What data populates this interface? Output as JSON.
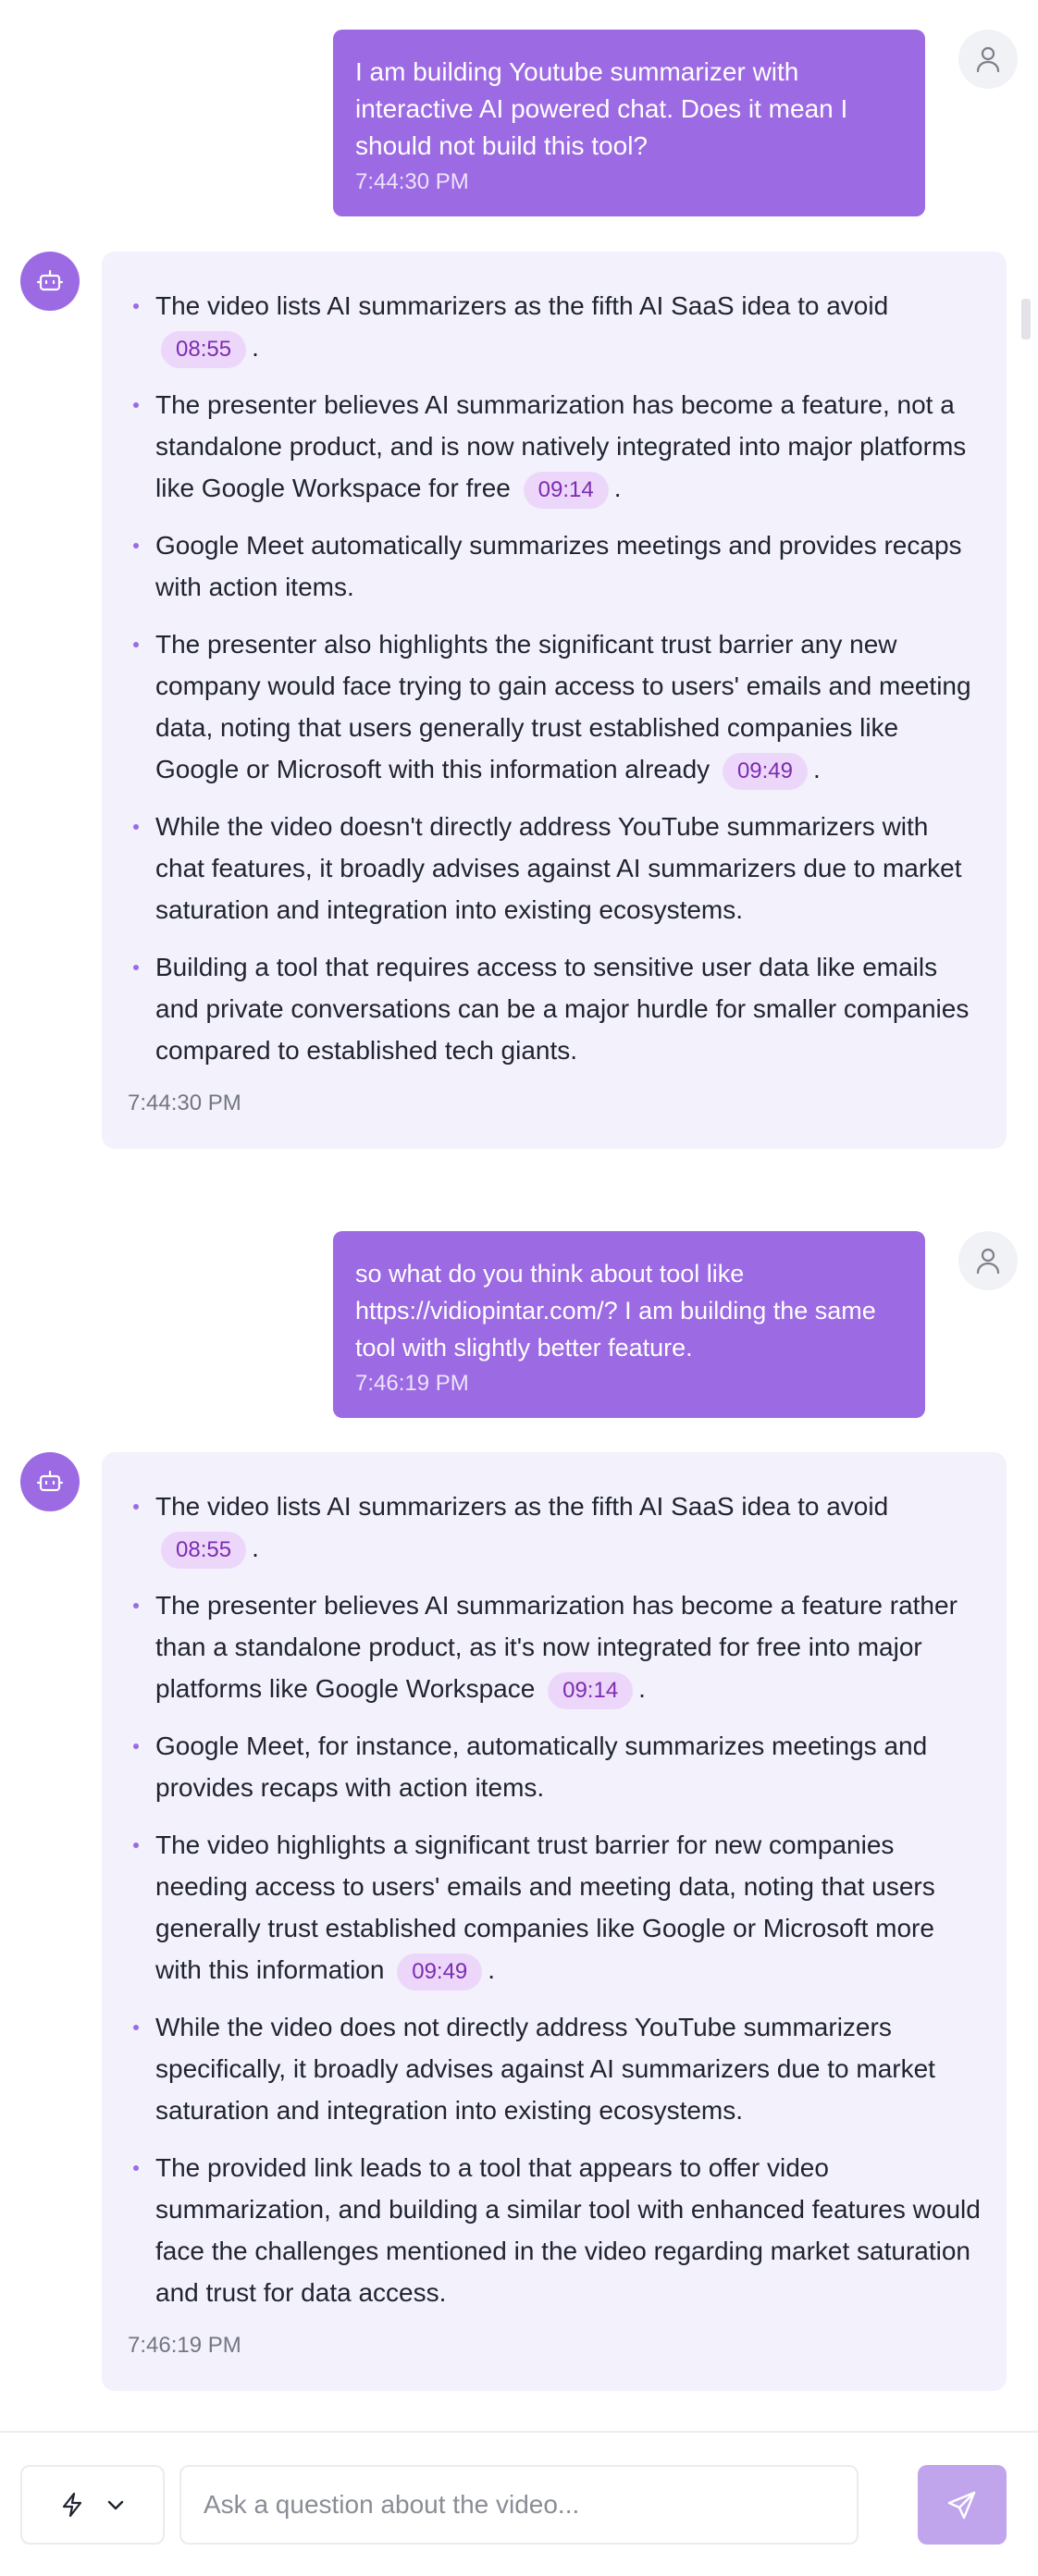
{
  "conversation": {
    "messages": [
      {
        "role": "user",
        "text": "I am building Youtube summarizer with interactive AI powered chat. Does it mean I should not build this tool?",
        "time": "7:44:30 PM"
      },
      {
        "role": "assistant",
        "time": "7:44:30 PM",
        "bullets": [
          {
            "text": "The video lists AI summarizers as the fifth AI SaaS idea to avoid",
            "timestamp": "08:55",
            "end": "."
          },
          {
            "text": "The presenter believes AI summarization has become a feature, not a standalone product, and is now natively integrated into major platforms like Google Workspace for free",
            "timestamp": "09:14",
            "end": "."
          },
          {
            "text": "Google Meet automatically summarizes meetings and provides recaps with action items."
          },
          {
            "text": "The presenter also highlights the significant trust barrier any new company would face trying to gain access to users' emails and meeting data, noting that users generally trust established companies like Google or Microsoft with this information already",
            "timestamp": "09:49",
            "end": "."
          },
          {
            "text": "While the video doesn't directly address YouTube summarizers with chat features, it broadly advises against AI summarizers due to market saturation and integration into existing ecosystems."
          },
          {
            "text": "Building a tool that requires access to sensitive user data like emails and private conversations can be a major hurdle for smaller companies compared to established tech giants."
          }
        ]
      },
      {
        "role": "user",
        "text": "so what do you think about tool like https://vidiopintar.com/? I am building the same tool with slightly better feature.",
        "time": "7:46:19 PM"
      },
      {
        "role": "assistant",
        "time": "7:46:19 PM",
        "bullets": [
          {
            "text": "The video lists AI summarizers as the fifth AI SaaS idea to avoid",
            "timestamp": "08:55",
            "end": "."
          },
          {
            "text": "The presenter believes AI summarization has become a feature rather than a standalone product, as it's now integrated for free into major platforms like Google Workspace",
            "timestamp": "09:14",
            "end": "."
          },
          {
            "text": "Google Meet, for instance, automatically summarizes meetings and provides recaps with action items."
          },
          {
            "text": "The video highlights a significant trust barrier for new companies needing access to users' emails and meeting data, noting that users generally trust established companies like Google or Microsoft more with this information",
            "timestamp": "09:49",
            "end": "."
          },
          {
            "text": "While the video does not directly address YouTube summarizers specifically, it broadly advises against AI summarizers due to market saturation and integration into existing ecosystems."
          },
          {
            "text": "The provided link leads to a tool that appears to offer video summarization, and building a similar tool with enhanced features would face the challenges mentioned in the video regarding market saturation and trust for data access."
          }
        ]
      }
    ]
  },
  "input_bar": {
    "placeholder": "Ask a question about the video...",
    "value": "",
    "mode_icon": "lightning-icon",
    "dropdown_icon": "chevron-down-icon",
    "send_icon": "send-icon"
  },
  "icons": {
    "user_avatar": "user-icon",
    "bot_avatar": "bot-icon"
  },
  "colors": {
    "accent": "#9c6ae3",
    "user_bubble": "#9c6ae3",
    "assistant_bubble": "#f3f1fc",
    "timestamp_chip_bg": "#ecd7fb",
    "timestamp_chip_text": "#7d2bb0",
    "send_button": "#c0a5ed"
  }
}
